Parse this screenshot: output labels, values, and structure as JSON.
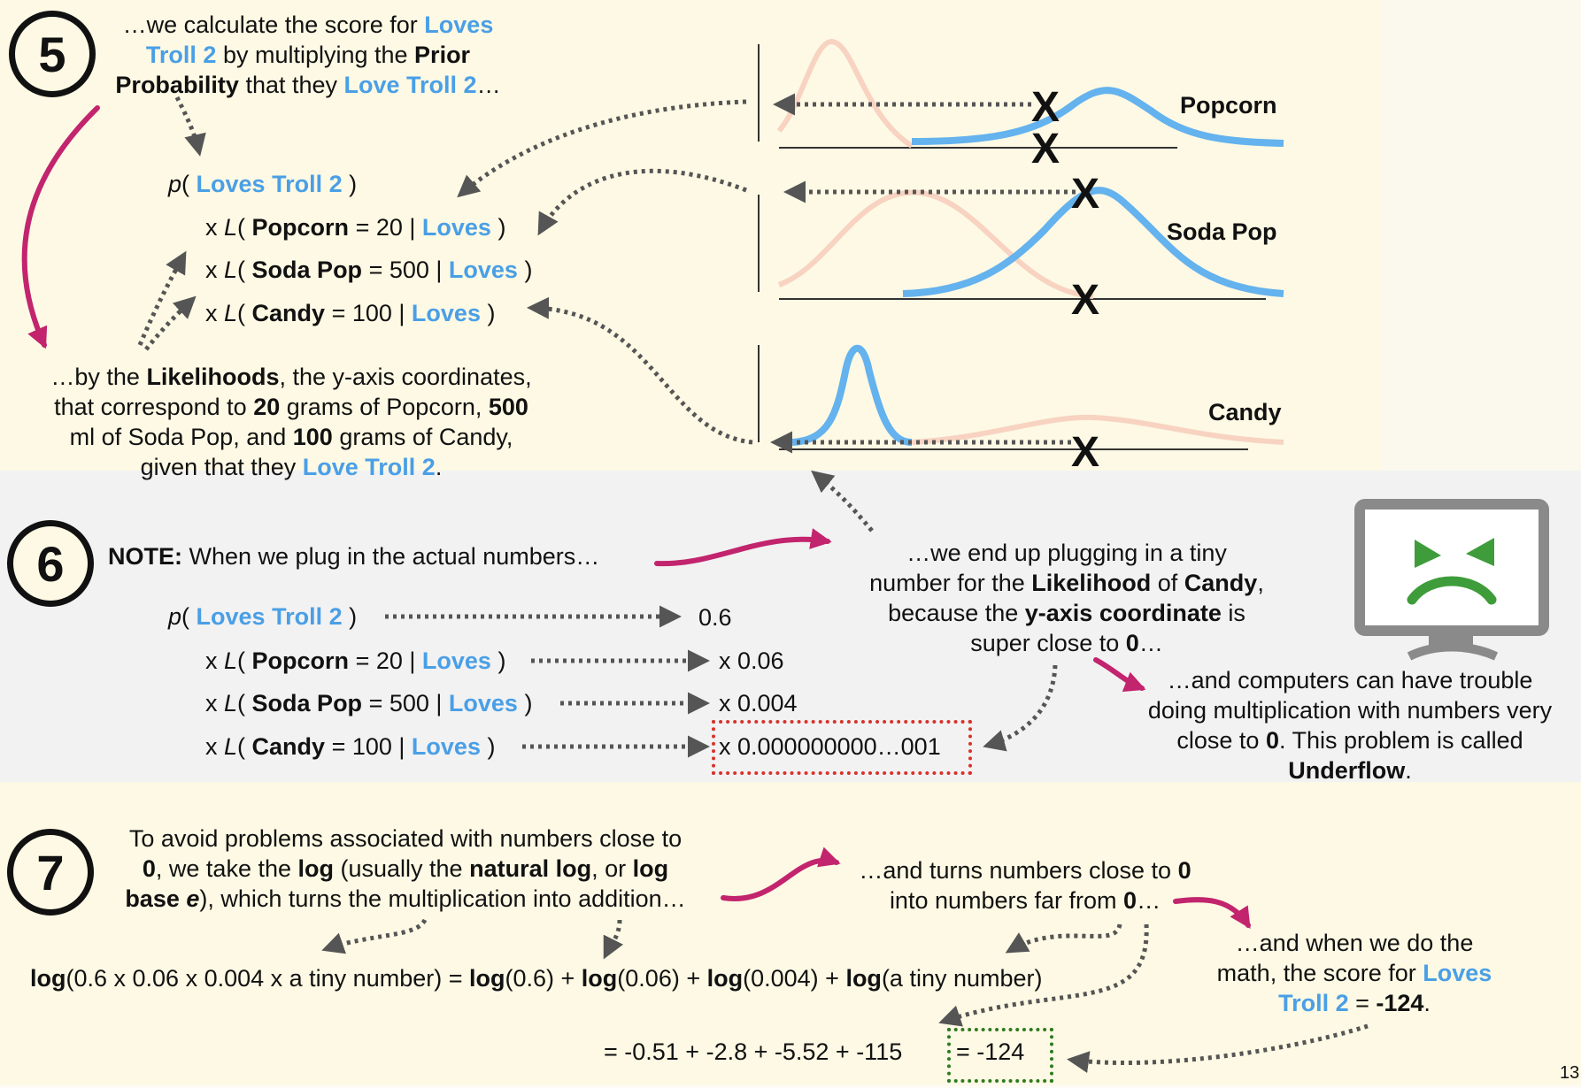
{
  "step5": {
    "number": "5",
    "intro": {
      "l1a": "…we calculate the score for ",
      "l1b": "Loves",
      "l2a": "Troll 2",
      "l2b": " by multiplying the ",
      "l2c": "Prior",
      "l3a": "Probability",
      "l3b": " that they ",
      "l3c": "Love Troll 2",
      "l3d": "…"
    },
    "formula": {
      "prior": {
        "p": "p",
        "open": "( ",
        "term": "Loves Troll 2",
        "close": " )"
      },
      "rows": [
        {
          "x": "x ",
          "L": "L",
          "open": "( ",
          "feature": "Popcorn",
          "eq": " = 20 | ",
          "cond": "Loves",
          "close": " )"
        },
        {
          "x": "x ",
          "L": "L",
          "open": "( ",
          "feature": "Soda Pop",
          "eq": " = 500 | ",
          "cond": "Loves",
          "close": " )"
        },
        {
          "x": "x ",
          "L": "L",
          "open": "( ",
          "feature": "Candy",
          "eq": " = 100 | ",
          "cond": "Loves",
          "close": " )"
        }
      ]
    },
    "likelihood_text": {
      "l1a": "…by the ",
      "l1b": "Likelihoods",
      "l1c": ", the y-axis coordinates,",
      "l2a": "that correspond to ",
      "l2b": "20",
      "l2c": " grams of Popcorn, ",
      "l2d": "500",
      "l3a": "ml of Soda Pop, and ",
      "l3b": "100",
      "l3c": " grams of Candy,",
      "l4a": "given that they ",
      "l4b": "Love Troll 2",
      "l4c": "."
    },
    "plots": [
      {
        "label": "Popcorn",
        "marker": "X"
      },
      {
        "label": "Soda Pop",
        "marker": "X"
      },
      {
        "label": "Candy",
        "marker": "X"
      }
    ]
  },
  "step6": {
    "number": "6",
    "note_label": "NOTE:",
    "note_text": " When we plug in the actual numbers…",
    "rows": [
      {
        "value": "0.6"
      },
      {
        "value": "x 0.06"
      },
      {
        "value": "x 0.004"
      },
      {
        "value": "x 0.000000000…001"
      }
    ],
    "tiny": {
      "l1": "…we end up plugging in a tiny",
      "l2a": "number for the ",
      "l2b": "Likelihood",
      "l2c": " of ",
      "l2d": "Candy",
      "l2e": ",",
      "l3a": "because the ",
      "l3b": "y-axis coordinate",
      "l3c": " is",
      "l4a": "super close to ",
      "l4b": "0",
      "l4c": "…"
    },
    "underflow": {
      "l1": "…and computers can have trouble",
      "l2": "doing multiplication with numbers very",
      "l3a": "close to ",
      "l3b": "0",
      "l3c": ". This problem is called",
      "l4": "Underflow",
      "l4b": "."
    }
  },
  "step7": {
    "number": "7",
    "intro": {
      "l1": "To avoid problems associated with numbers close to",
      "l2a": "0",
      "l2b": ", we take the ",
      "l2c": "log",
      "l2d": " (usually the ",
      "l2e": "natural log",
      "l2f": ", or ",
      "l2g": "log",
      "l3a": "base ",
      "l3b": "e",
      "l3c": "), which turns the multiplication into addition…"
    },
    "far": {
      "l1a": "…and turns numbers close to ",
      "l1b": "0",
      "l2a": "into numbers far from ",
      "l2b": "0",
      "l2c": "…"
    },
    "log_eq": {
      "a": "log",
      "b": "(0.6 x 0.06 x 0.004 x a tiny number) = ",
      "c": "log",
      "d": "(0.6) + ",
      "e": "log",
      "f": "(0.06) + ",
      "g": "log",
      "h": "(0.004) + ",
      "i": "log",
      "j": "(a tiny number)"
    },
    "sum": "= -0.51 + -2.8 + -5.52 + -115 ",
    "result": "= -124",
    "score": {
      "l1": "…and when we do the",
      "l2a": "math, the score for ",
      "l2b": "Loves",
      "l3a": "Troll 2",
      "l3b": " = ",
      "l3c": "-124",
      "l3d": "."
    }
  },
  "page_number": "13"
}
